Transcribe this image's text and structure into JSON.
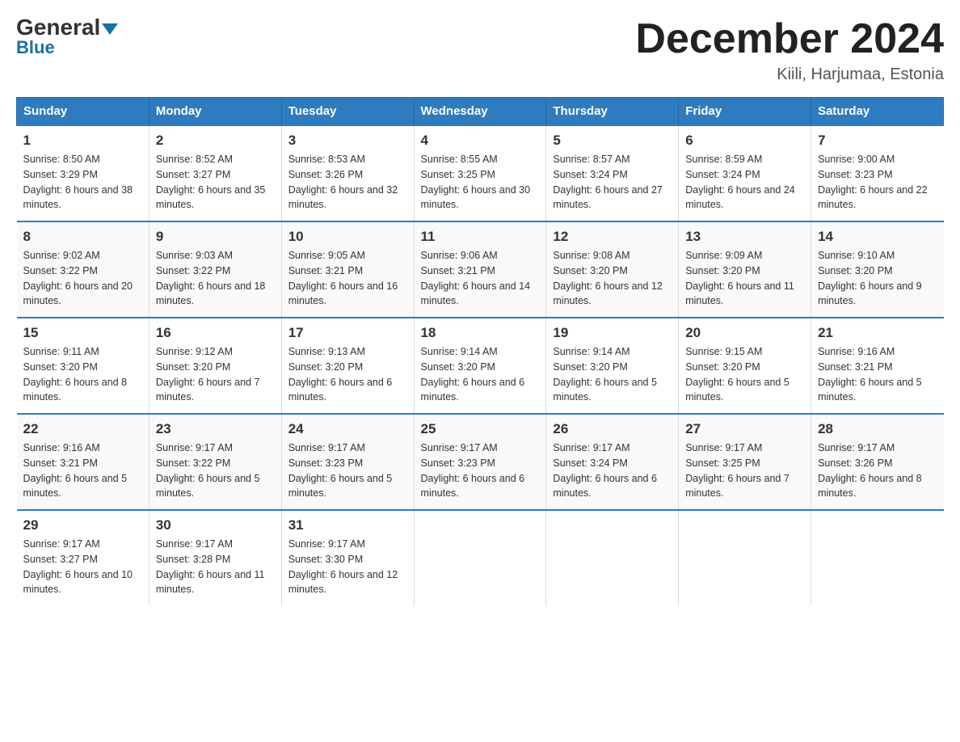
{
  "header": {
    "logo_general": "General",
    "logo_blue": "Blue",
    "month_title": "December 2024",
    "location": "Kiili, Harjumaa, Estonia"
  },
  "days_of_week": [
    "Sunday",
    "Monday",
    "Tuesday",
    "Wednesday",
    "Thursday",
    "Friday",
    "Saturday"
  ],
  "weeks": [
    [
      {
        "day": "1",
        "sunrise": "Sunrise: 8:50 AM",
        "sunset": "Sunset: 3:29 PM",
        "daylight": "Daylight: 6 hours and 38 minutes."
      },
      {
        "day": "2",
        "sunrise": "Sunrise: 8:52 AM",
        "sunset": "Sunset: 3:27 PM",
        "daylight": "Daylight: 6 hours and 35 minutes."
      },
      {
        "day": "3",
        "sunrise": "Sunrise: 8:53 AM",
        "sunset": "Sunset: 3:26 PM",
        "daylight": "Daylight: 6 hours and 32 minutes."
      },
      {
        "day": "4",
        "sunrise": "Sunrise: 8:55 AM",
        "sunset": "Sunset: 3:25 PM",
        "daylight": "Daylight: 6 hours and 30 minutes."
      },
      {
        "day": "5",
        "sunrise": "Sunrise: 8:57 AM",
        "sunset": "Sunset: 3:24 PM",
        "daylight": "Daylight: 6 hours and 27 minutes."
      },
      {
        "day": "6",
        "sunrise": "Sunrise: 8:59 AM",
        "sunset": "Sunset: 3:24 PM",
        "daylight": "Daylight: 6 hours and 24 minutes."
      },
      {
        "day": "7",
        "sunrise": "Sunrise: 9:00 AM",
        "sunset": "Sunset: 3:23 PM",
        "daylight": "Daylight: 6 hours and 22 minutes."
      }
    ],
    [
      {
        "day": "8",
        "sunrise": "Sunrise: 9:02 AM",
        "sunset": "Sunset: 3:22 PM",
        "daylight": "Daylight: 6 hours and 20 minutes."
      },
      {
        "day": "9",
        "sunrise": "Sunrise: 9:03 AM",
        "sunset": "Sunset: 3:22 PM",
        "daylight": "Daylight: 6 hours and 18 minutes."
      },
      {
        "day": "10",
        "sunrise": "Sunrise: 9:05 AM",
        "sunset": "Sunset: 3:21 PM",
        "daylight": "Daylight: 6 hours and 16 minutes."
      },
      {
        "day": "11",
        "sunrise": "Sunrise: 9:06 AM",
        "sunset": "Sunset: 3:21 PM",
        "daylight": "Daylight: 6 hours and 14 minutes."
      },
      {
        "day": "12",
        "sunrise": "Sunrise: 9:08 AM",
        "sunset": "Sunset: 3:20 PM",
        "daylight": "Daylight: 6 hours and 12 minutes."
      },
      {
        "day": "13",
        "sunrise": "Sunrise: 9:09 AM",
        "sunset": "Sunset: 3:20 PM",
        "daylight": "Daylight: 6 hours and 11 minutes."
      },
      {
        "day": "14",
        "sunrise": "Sunrise: 9:10 AM",
        "sunset": "Sunset: 3:20 PM",
        "daylight": "Daylight: 6 hours and 9 minutes."
      }
    ],
    [
      {
        "day": "15",
        "sunrise": "Sunrise: 9:11 AM",
        "sunset": "Sunset: 3:20 PM",
        "daylight": "Daylight: 6 hours and 8 minutes."
      },
      {
        "day": "16",
        "sunrise": "Sunrise: 9:12 AM",
        "sunset": "Sunset: 3:20 PM",
        "daylight": "Daylight: 6 hours and 7 minutes."
      },
      {
        "day": "17",
        "sunrise": "Sunrise: 9:13 AM",
        "sunset": "Sunset: 3:20 PM",
        "daylight": "Daylight: 6 hours and 6 minutes."
      },
      {
        "day": "18",
        "sunrise": "Sunrise: 9:14 AM",
        "sunset": "Sunset: 3:20 PM",
        "daylight": "Daylight: 6 hours and 6 minutes."
      },
      {
        "day": "19",
        "sunrise": "Sunrise: 9:14 AM",
        "sunset": "Sunset: 3:20 PM",
        "daylight": "Daylight: 6 hours and 5 minutes."
      },
      {
        "day": "20",
        "sunrise": "Sunrise: 9:15 AM",
        "sunset": "Sunset: 3:20 PM",
        "daylight": "Daylight: 6 hours and 5 minutes."
      },
      {
        "day": "21",
        "sunrise": "Sunrise: 9:16 AM",
        "sunset": "Sunset: 3:21 PM",
        "daylight": "Daylight: 6 hours and 5 minutes."
      }
    ],
    [
      {
        "day": "22",
        "sunrise": "Sunrise: 9:16 AM",
        "sunset": "Sunset: 3:21 PM",
        "daylight": "Daylight: 6 hours and 5 minutes."
      },
      {
        "day": "23",
        "sunrise": "Sunrise: 9:17 AM",
        "sunset": "Sunset: 3:22 PM",
        "daylight": "Daylight: 6 hours and 5 minutes."
      },
      {
        "day": "24",
        "sunrise": "Sunrise: 9:17 AM",
        "sunset": "Sunset: 3:23 PM",
        "daylight": "Daylight: 6 hours and 5 minutes."
      },
      {
        "day": "25",
        "sunrise": "Sunrise: 9:17 AM",
        "sunset": "Sunset: 3:23 PM",
        "daylight": "Daylight: 6 hours and 6 minutes."
      },
      {
        "day": "26",
        "sunrise": "Sunrise: 9:17 AM",
        "sunset": "Sunset: 3:24 PM",
        "daylight": "Daylight: 6 hours and 6 minutes."
      },
      {
        "day": "27",
        "sunrise": "Sunrise: 9:17 AM",
        "sunset": "Sunset: 3:25 PM",
        "daylight": "Daylight: 6 hours and 7 minutes."
      },
      {
        "day": "28",
        "sunrise": "Sunrise: 9:17 AM",
        "sunset": "Sunset: 3:26 PM",
        "daylight": "Daylight: 6 hours and 8 minutes."
      }
    ],
    [
      {
        "day": "29",
        "sunrise": "Sunrise: 9:17 AM",
        "sunset": "Sunset: 3:27 PM",
        "daylight": "Daylight: 6 hours and 10 minutes."
      },
      {
        "day": "30",
        "sunrise": "Sunrise: 9:17 AM",
        "sunset": "Sunset: 3:28 PM",
        "daylight": "Daylight: 6 hours and 11 minutes."
      },
      {
        "day": "31",
        "sunrise": "Sunrise: 9:17 AM",
        "sunset": "Sunset: 3:30 PM",
        "daylight": "Daylight: 6 hours and 12 minutes."
      },
      null,
      null,
      null,
      null
    ]
  ]
}
